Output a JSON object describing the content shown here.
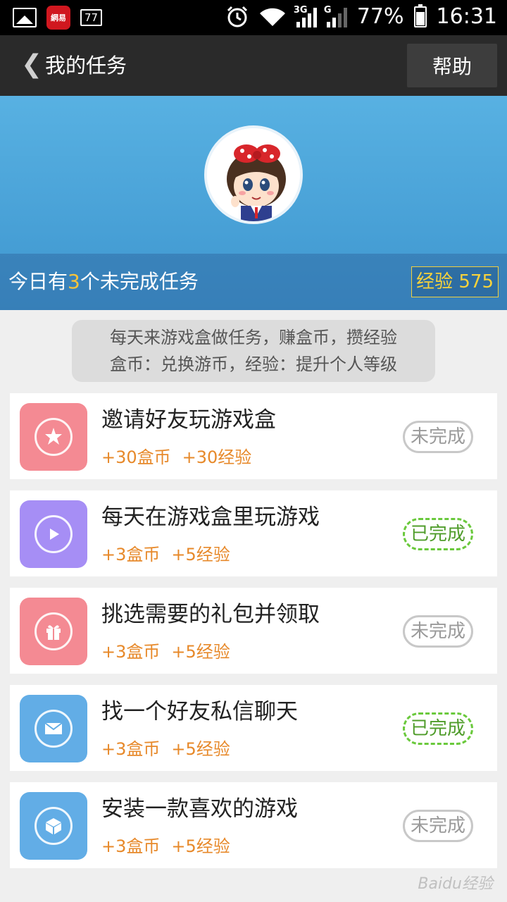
{
  "status_bar": {
    "app_badge": "網易",
    "notif_count": "77",
    "net1": "3G",
    "net2": "G",
    "battery": "77%",
    "time": "16:31"
  },
  "header": {
    "title": "我的任务",
    "help_label": "帮助"
  },
  "summary": {
    "prefix": "今日有",
    "count": "3",
    "suffix": "个未完成任务",
    "exp_label": "经验 575"
  },
  "tip": {
    "line1": "每天来游戏盒做任务，赚盒币，攒经验",
    "line2": "盒币：兑换游币，经验：提升个人等级"
  },
  "tasks": [
    {
      "title": "邀请好友玩游戏盒",
      "coins": "+30盒币",
      "exp": "+30经验",
      "status": "未完成",
      "icon": "invite-star-icon",
      "color": "#f48a93"
    },
    {
      "title": "每天在游戏盒里玩游戏",
      "coins": "+3盒币",
      "exp": "+5经验",
      "status": "已完成",
      "icon": "play-icon",
      "color": "#a68ef5"
    },
    {
      "title": "挑选需要的礼包并领取",
      "coins": "+3盒币",
      "exp": "+5经验",
      "status": "未完成",
      "icon": "gift-icon",
      "color": "#f48a93"
    },
    {
      "title": "找一个好友私信聊天",
      "coins": "+3盒币",
      "exp": "+5经验",
      "status": "已完成",
      "icon": "mail-icon",
      "color": "#62ade6"
    },
    {
      "title": "安装一款喜欢的游戏",
      "coins": "+3盒币",
      "exp": "+5经验",
      "status": "未完成",
      "icon": "cube-icon",
      "color": "#62ade6"
    }
  ],
  "watermark": "Baidu经验"
}
